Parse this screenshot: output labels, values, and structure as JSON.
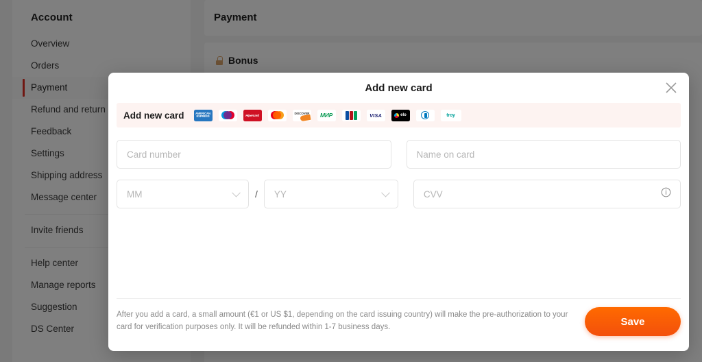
{
  "background": {
    "sidebar": {
      "title": "Account",
      "groups": [
        {
          "items": [
            {
              "label": "Overview",
              "active": false
            },
            {
              "label": "Orders",
              "active": false
            },
            {
              "label": "Payment",
              "active": true
            },
            {
              "label": "Refund and return",
              "active": false
            },
            {
              "label": "Feedback",
              "active": false
            },
            {
              "label": "Settings",
              "active": false
            },
            {
              "label": "Shipping address",
              "active": false
            },
            {
              "label": "Message center",
              "active": false
            }
          ]
        },
        {
          "items": [
            {
              "label": "Invite friends",
              "active": false
            }
          ]
        },
        {
          "items": [
            {
              "label": "Help center",
              "active": false
            },
            {
              "label": "Manage reports",
              "active": false
            },
            {
              "label": "Suggestion",
              "active": false
            },
            {
              "label": "DS Center",
              "active": false
            }
          ]
        }
      ]
    },
    "content": {
      "page_title": "Payment",
      "bonus_section_label": "Bonus"
    }
  },
  "modal": {
    "title": "Add new card",
    "close_label": "×",
    "brand_bar": {
      "label": "Add new card",
      "brands": [
        {
          "name": "amex",
          "text": "AMERICAN EXPRESS"
        },
        {
          "name": "maestro",
          "text": "Maestro"
        },
        {
          "name": "hipercard",
          "text": "Hipercard"
        },
        {
          "name": "mastercard",
          "text": "Mastercard"
        },
        {
          "name": "discover",
          "text": "DISCOVER"
        },
        {
          "name": "mir",
          "text": "МИР"
        },
        {
          "name": "jcb",
          "text": "JCB"
        },
        {
          "name": "visa",
          "text": "VISA"
        },
        {
          "name": "elo",
          "text": "elo"
        },
        {
          "name": "diners",
          "text": "Diners Club"
        },
        {
          "name": "troy",
          "text": "troy"
        }
      ]
    },
    "fields": {
      "card_number_placeholder": "Card number",
      "name_on_card_placeholder": "Name on card",
      "expiry_month_placeholder": "MM",
      "expiry_separator": "/",
      "expiry_year_placeholder": "YY",
      "cvv_placeholder": "CVV"
    },
    "footer": {
      "disclaimer": "After you add a card, a small amount (€1 or US $1, depending on the card issuing country) will make the pre-authorization to your card for verification purposes only. It will be refunded within 1-7 business days.",
      "save_label": "Save"
    }
  },
  "colors": {
    "accent_orange": "#f3500c",
    "active_bar_red": "#e02e24",
    "brand_bar_bg": "#fdf3f1",
    "overlay": "rgba(0,0,0,0.50)"
  }
}
